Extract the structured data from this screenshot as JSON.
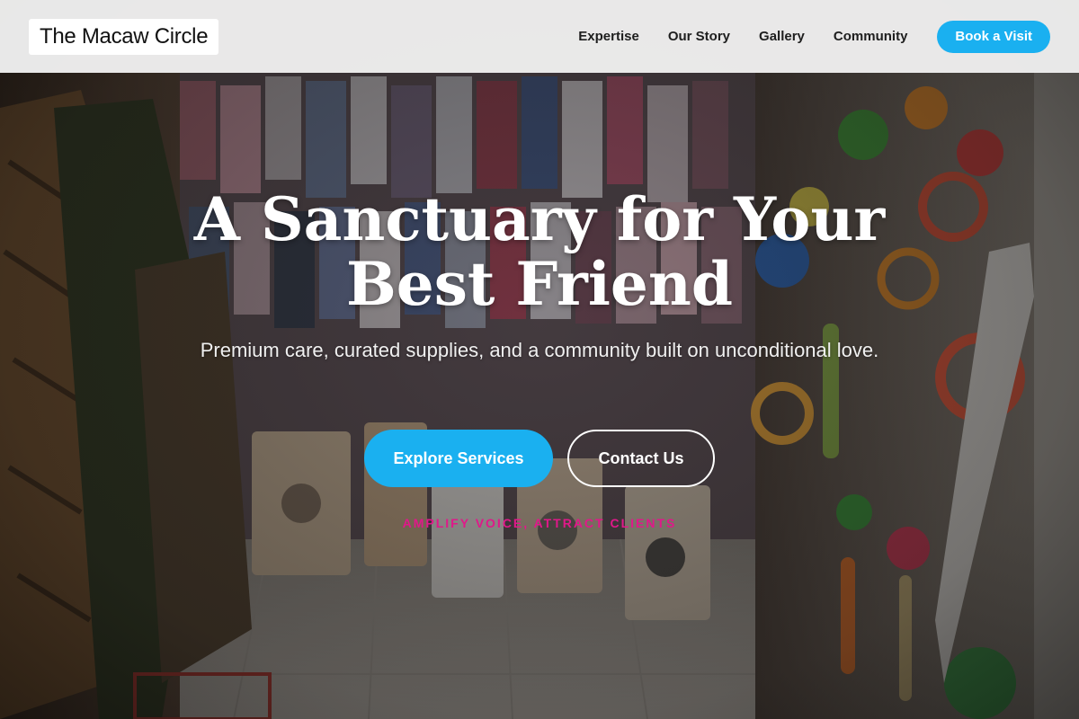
{
  "header": {
    "logo": "The Macaw Circle",
    "nav": [
      {
        "label": "Expertise"
      },
      {
        "label": "Our Story"
      },
      {
        "label": "Gallery"
      },
      {
        "label": "Community"
      }
    ],
    "cta_label": "Book a Visit"
  },
  "hero": {
    "title": "A Sanctuary for Your Best Friend",
    "subtitle": "Premium care, curated supplies, and a community built on unconditional love.",
    "primary_button": "Explore Services",
    "secondary_button": "Contact Us",
    "tagline": "AMPLIFY VOICE, ATTRACT CLIENTS"
  },
  "colors": {
    "accent": "#1ab0f0",
    "tagline": "#e0188a",
    "header_bg": "#f8f8f8"
  }
}
